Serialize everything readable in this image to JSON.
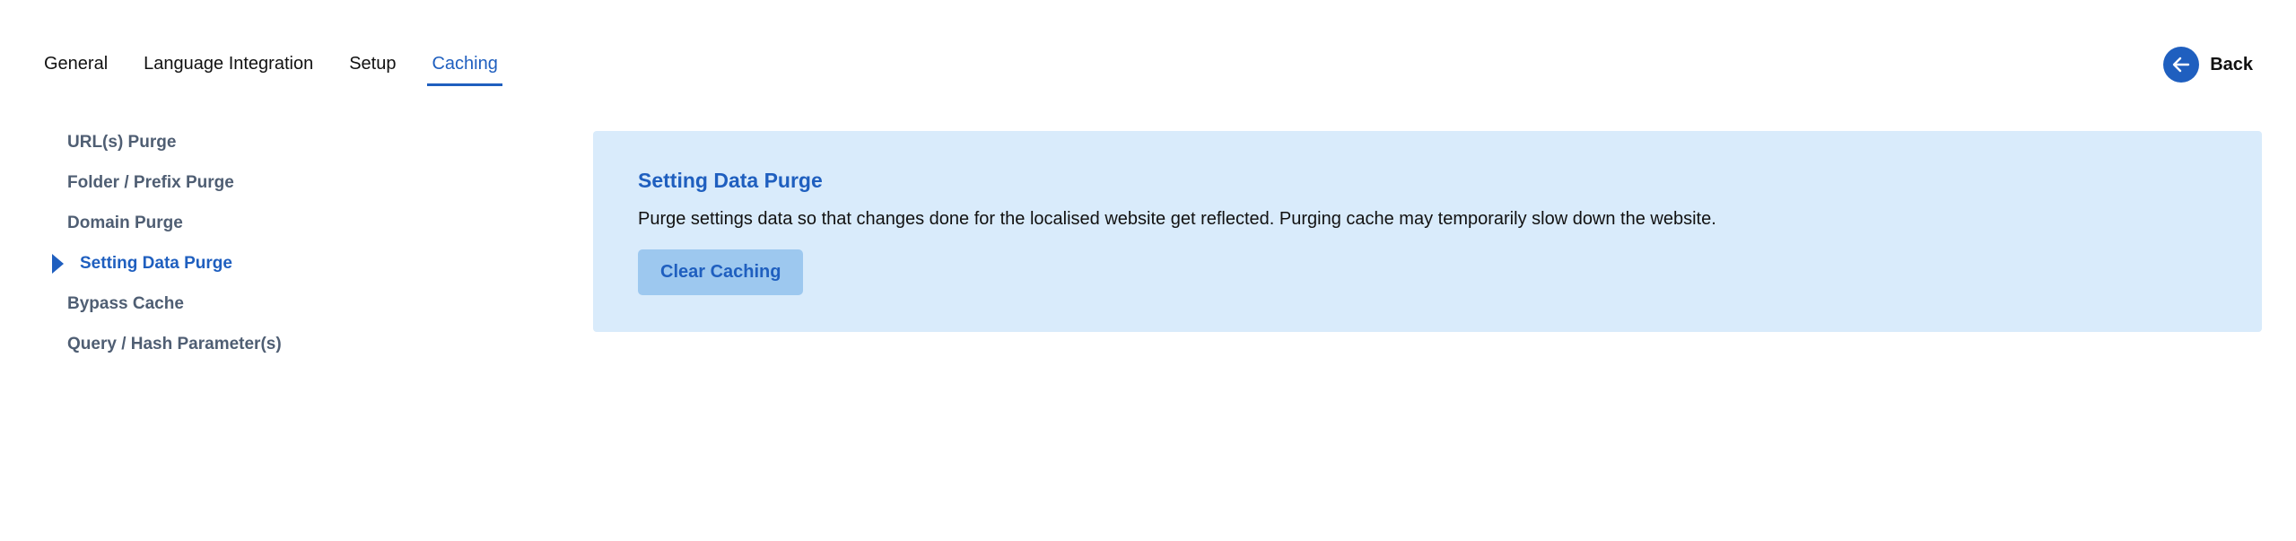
{
  "tabs": [
    {
      "label": "General",
      "active": false
    },
    {
      "label": "Language Integration",
      "active": false
    },
    {
      "label": "Setup",
      "active": false
    },
    {
      "label": "Caching",
      "active": true
    }
  ],
  "back": {
    "label": "Back",
    "icon": "arrow-left-icon"
  },
  "sidebar": {
    "items": [
      {
        "label": "URL(s) Purge",
        "active": false
      },
      {
        "label": "Folder / Prefix Purge",
        "active": false
      },
      {
        "label": "Domain Purge",
        "active": false
      },
      {
        "label": "Setting Data Purge",
        "active": true
      },
      {
        "label": "Bypass Cache",
        "active": false
      },
      {
        "label": "Query / Hash Parameter(s)",
        "active": false
      }
    ]
  },
  "panel": {
    "title": "Setting Data Purge",
    "description": "Purge settings data so that changes done for the localised website get reflected. Purging cache may temporarily slow down the website.",
    "button_label": "Clear Caching"
  },
  "colors": {
    "accent": "#1f5fbf",
    "panel_bg": "#d9ebfb",
    "button_bg": "#9dc8ef",
    "sidebar_text": "#4f5e73"
  }
}
